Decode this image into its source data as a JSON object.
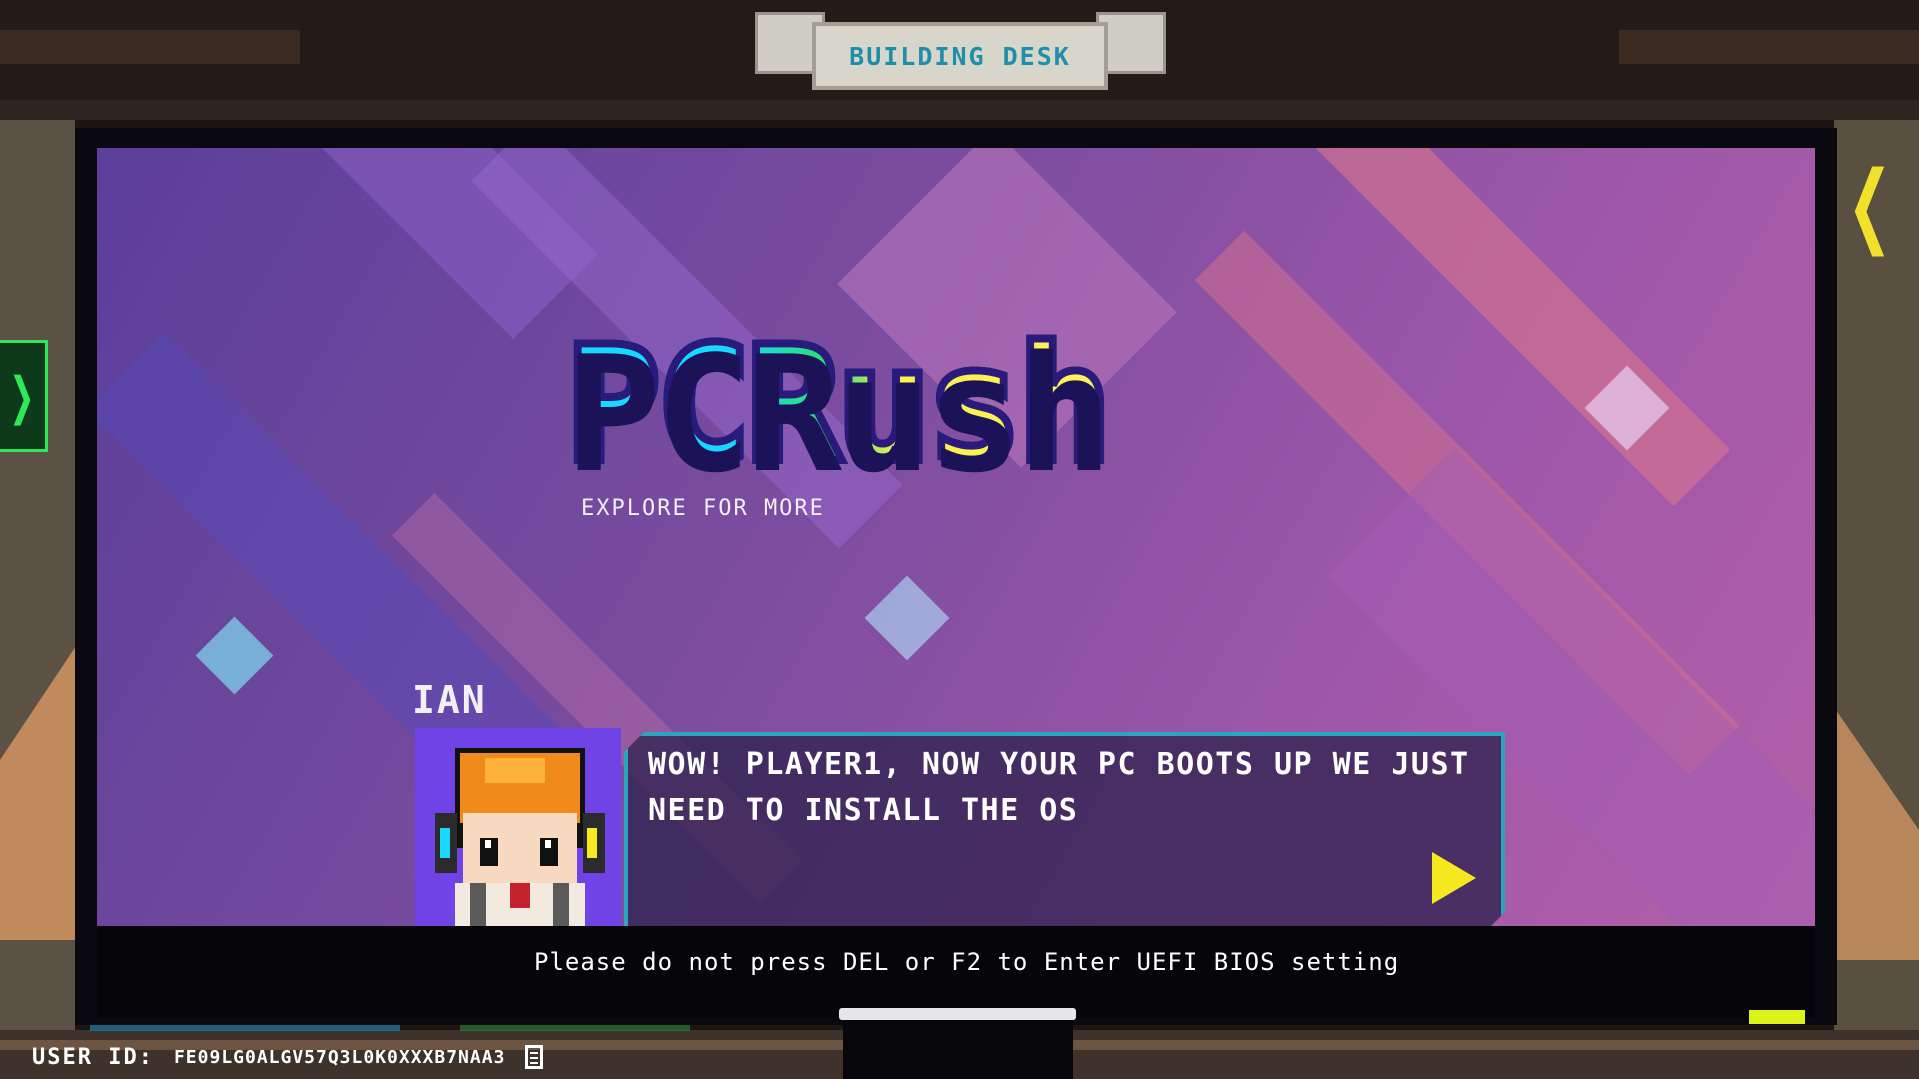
{
  "sign": {
    "title": "BUILDING DESK"
  },
  "game": {
    "logo": "PCRush",
    "tagline": "EXPLORE FOR MORE"
  },
  "dialog": {
    "speaker": "IAN",
    "message": "WOW! PLAYER1, NOW YOUR PC BOOTS UP WE JUST NEED TO INSTALL THE OS",
    "next_icon": "play-triangle-icon"
  },
  "bios": {
    "text": "Please do not press DEL or F2 to Enter UEFI BIOS setting"
  },
  "footer": {
    "user_id_label": "USER ID:",
    "user_id_value": "FE09LG0ALGV57Q3L0K0XXXB7NAA3",
    "copy_icon": "copy-icon"
  },
  "side_tabs": {
    "left_icon": "chevron-right-icon",
    "right_icon": "chevron-left-icon"
  },
  "colors": {
    "accent_cyan": "#18d8ff",
    "accent_yellow": "#f6ea1e",
    "accent_green": "#2ee85a",
    "dialog_border": "#2aa6c0",
    "portrait_bg": "#6f43e6"
  }
}
